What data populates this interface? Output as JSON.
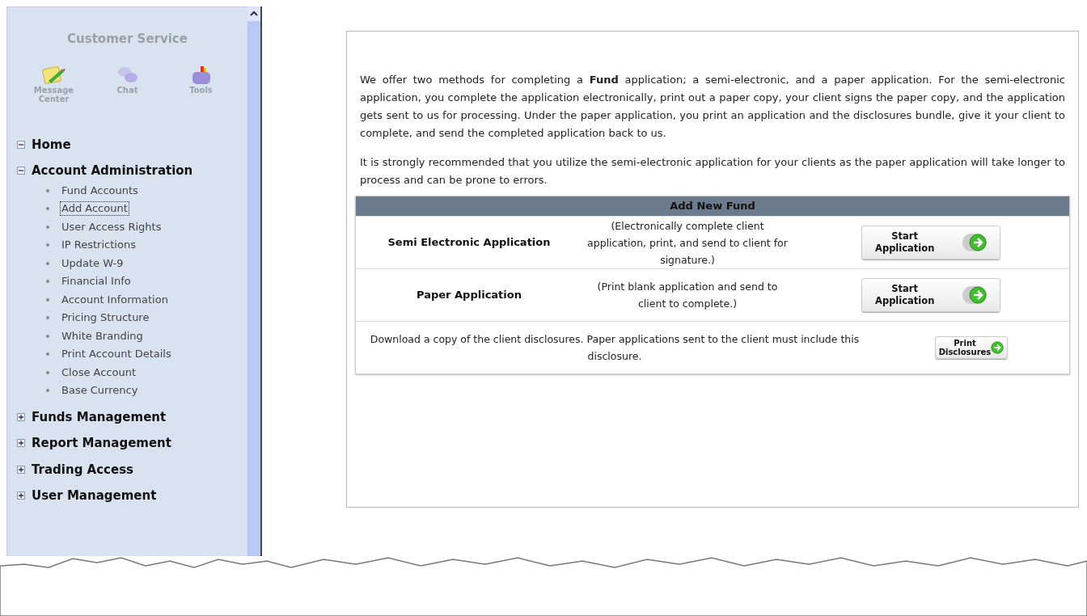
{
  "sidebar": {
    "title": "Customer Service",
    "shortcuts": [
      {
        "kind": "message",
        "label": "Message Center"
      },
      {
        "kind": "chat",
        "label": "Chat"
      },
      {
        "kind": "tools",
        "label": "Tools"
      }
    ],
    "sections": [
      {
        "label": "Home",
        "expanded": true
      },
      {
        "label": "Account Administration",
        "expanded": true,
        "children": [
          {
            "label": "Fund Accounts",
            "selected": false
          },
          {
            "label": "Add Account",
            "selected": true
          },
          {
            "label": "User Access Rights",
            "selected": false
          },
          {
            "label": "IP Restrictions",
            "selected": false
          },
          {
            "label": "Update W-9",
            "selected": false
          },
          {
            "label": "Financial Info",
            "selected": false
          },
          {
            "label": "Account Information",
            "selected": false
          },
          {
            "label": "Pricing Structure",
            "selected": false
          },
          {
            "label": "White Branding",
            "selected": false
          },
          {
            "label": "Print Account Details",
            "selected": false
          },
          {
            "label": "Close Account",
            "selected": false
          },
          {
            "label": "Base Currency",
            "selected": false
          }
        ]
      },
      {
        "label": "Funds Management",
        "expanded": false
      },
      {
        "label": "Report Management",
        "expanded": false
      },
      {
        "label": "Trading Access",
        "expanded": false
      },
      {
        "label": "User Management",
        "expanded": false
      }
    ]
  },
  "intro": [
    "We offer two methods for completing a **Fund** application; a semi-electronic, and a paper application. For the semi-electronic application, you complete the application electronically, print out a paper copy, your client signs the paper copy, and the application gets sent to us for processing. Under the paper application, you print an application and the disclosures bundle, give it your client to complete, and send the completed application back to us.",
    "It is strongly recommended that you utilize the semi-electronic application for your clients as the paper application will take longer to process and can be prone to errors."
  ],
  "table": {
    "header": "Add New Fund",
    "rows": [
      {
        "kind": "option",
        "name": "Semi Electronic Application",
        "description": "(Electronically complete client application, print, and send to client for signature.)",
        "button": [
          "Start",
          "Application"
        ]
      },
      {
        "kind": "option",
        "name": "Paper Application",
        "description": "(Print blank application and send to client to complete.)",
        "button": [
          "Start",
          "Application"
        ]
      },
      {
        "kind": "download",
        "description": "Download a copy of the client disclosures. Paper applications sent to the client must include this disclosure.",
        "button": [
          "Print",
          "Disclosures"
        ]
      }
    ]
  }
}
